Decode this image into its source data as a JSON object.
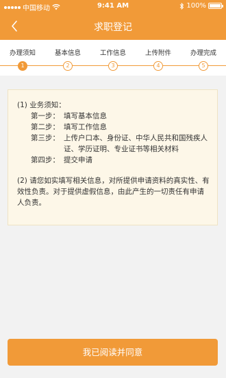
{
  "status_bar": {
    "carrier": "中国移动",
    "time": "9:41 AM",
    "battery": "100%"
  },
  "nav": {
    "title": "求职登记"
  },
  "steps": [
    {
      "label": "办理须知",
      "num": "1",
      "active": true
    },
    {
      "label": "基本信息",
      "num": "2",
      "active": false
    },
    {
      "label": "工作信息",
      "num": "3",
      "active": false
    },
    {
      "label": "上传附件",
      "num": "4",
      "active": false
    },
    {
      "label": "办理完成",
      "num": "5",
      "active": false
    }
  ],
  "notice": {
    "section1_title": "(1) 业务须知：",
    "items": [
      {
        "key": "第一步：",
        "value": "填写基本信息"
      },
      {
        "key": "第二步：",
        "value": "填写工作信息"
      },
      {
        "key": "第三步：",
        "value": "上传户口本、身份证、中华人民共和国残疾人证、学历证明、专业证书等相关材料"
      },
      {
        "key": "第四步：",
        "value": "提交申请"
      }
    ],
    "section2": "(2) 请您如实填写相关信息，对所提供申请资料的真实性、有效性负责。对于提供虚假信息，由此产生的一切责任有申请人负责。"
  },
  "agree_button": {
    "label": "我已阅读并同意"
  },
  "colors": {
    "accent": "#f19a38",
    "notice_bg": "#fdf7e8",
    "page_bg": "#f2f2f2"
  }
}
